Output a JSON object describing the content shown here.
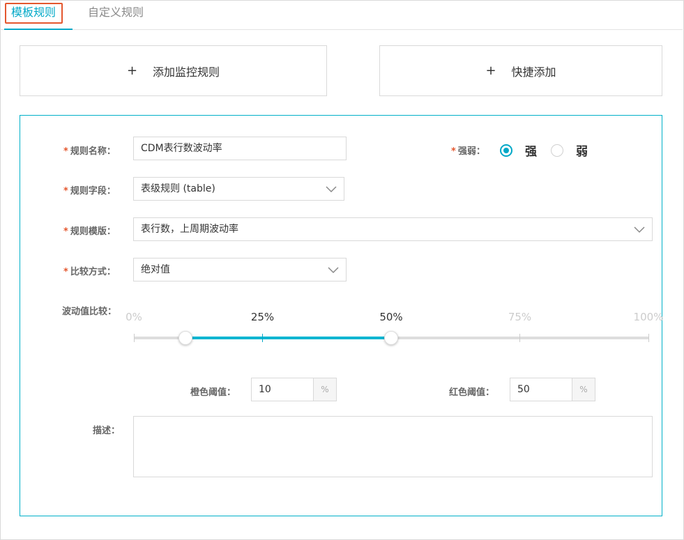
{
  "tabs": [
    {
      "label": "模板规则",
      "active": true
    },
    {
      "label": "自定义规则",
      "active": false
    }
  ],
  "actions": {
    "add_monitor_rule": {
      "plus": "+",
      "label": "添加监控规则"
    },
    "quick_add": {
      "plus": "+",
      "label": "快捷添加"
    }
  },
  "form": {
    "required_mark": "*",
    "rule_name": {
      "label": "规则名称：",
      "value": "CDM表行数波动率"
    },
    "strength": {
      "label": "强弱：",
      "options": [
        {
          "label": "强",
          "checked": true
        },
        {
          "label": "弱",
          "checked": false
        }
      ]
    },
    "rule_field": {
      "label": "规则字段：",
      "value": "表级规则 (table)"
    },
    "rule_template": {
      "label": "规则模版：",
      "value": "表行数，上周期波动率"
    },
    "compare_method": {
      "label": "比较方式：",
      "value": "绝对值"
    },
    "fluctuation": {
      "label": "波动值比较："
    },
    "description": {
      "label": "描述：",
      "value": ""
    }
  },
  "range_slider": {
    "ticks": [
      "0%",
      "25%",
      "50%",
      "75%",
      "100%"
    ],
    "low_percent": 10,
    "high_percent": 50
  },
  "thresholds": {
    "orange": {
      "label": "橙色阈值：",
      "value": "10",
      "unit": "%"
    },
    "red": {
      "label": "红色阈值：",
      "value": "50",
      "unit": "%"
    }
  },
  "colors": {
    "accent": "#00a8c7",
    "required": "#e4572e",
    "highlight_box": "#e4572e"
  }
}
